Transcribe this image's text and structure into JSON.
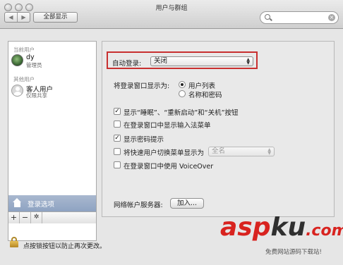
{
  "window": {
    "title": "用户与群组"
  },
  "toolbar": {
    "back_icon": "◀",
    "forward_icon": "▶",
    "show_all_label": "全部显示",
    "search_value": "",
    "search_clear_icon": "×"
  },
  "sidebar": {
    "current_users_header": "当前用户",
    "current_user": {
      "name": "dy",
      "role": "管理员"
    },
    "other_users_header": "其他用户",
    "guest_user": {
      "name": "客人用户",
      "role": "仅限共享"
    },
    "login_options_label": "登录选项",
    "add_icon": "+",
    "remove_icon": "−",
    "action_icon": "✲"
  },
  "main": {
    "auto_login_label": "自动登录:",
    "auto_login_value": "关闭",
    "display_login_as_label": "将登录窗口显示为:",
    "radio_user_list": "用户列表",
    "radio_name_password": "名称和密码",
    "cb_show_buttons": "显示“睡眠”、“重新启动”和“关机”按钮",
    "cb_input_menu": "在登录窗口中显示输入法菜单",
    "cb_password_hints": "显示密码提示",
    "cb_fast_user_switch": "将快速用户切换菜单显示为",
    "fast_user_switch_value": "全名",
    "cb_voiceover": "在登录窗口中使用 VoiceOver",
    "network_server_label": "网络帐户服务器:",
    "join_button": "加入...",
    "check_mark": "✓"
  },
  "footer": {
    "lock_text": "点按锁按钮以防止再次更改。"
  },
  "watermark": {
    "part1": "asp",
    "part2": "ku",
    "part3": ".com",
    "subtitle": "免费网站源码下载站!"
  },
  "colors": {
    "highlight_border": "#c83030",
    "selected_row": "#9aaccb",
    "lock": "#d2a53d"
  }
}
